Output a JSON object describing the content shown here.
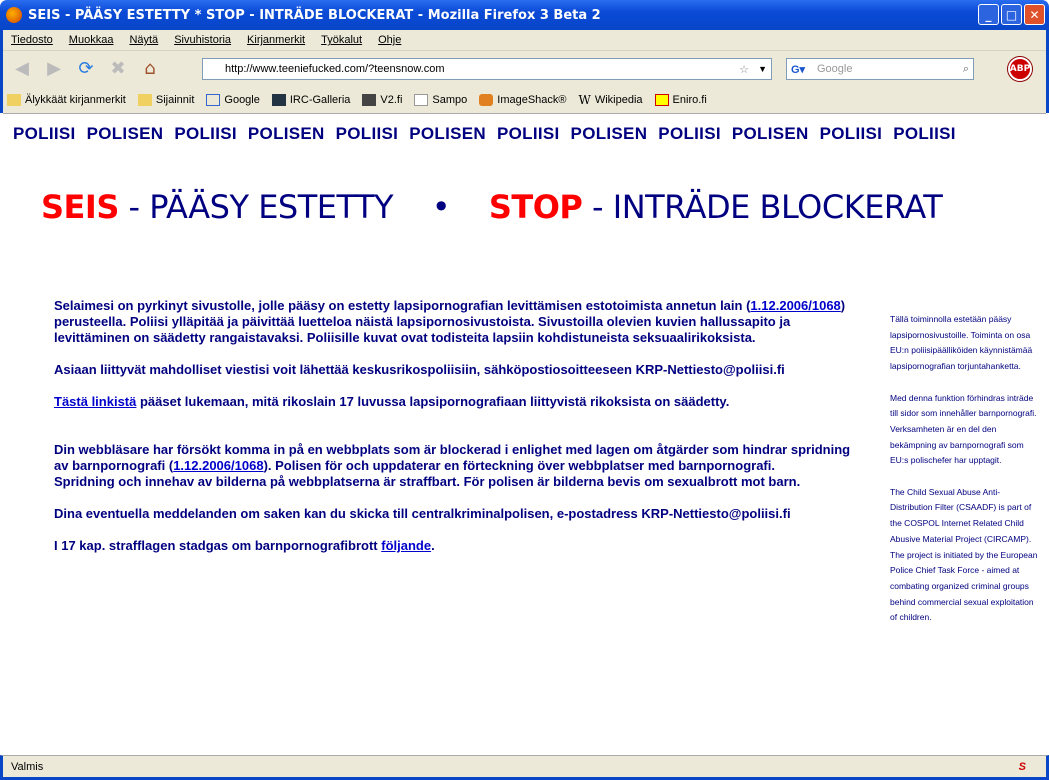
{
  "window": {
    "title": "SEIS - PÄÄSY ESTETTY * STOP - INTRÄDE BLOCKERAT - Mozilla Firefox 3 Beta 2"
  },
  "menu": [
    "Tiedosto",
    "Muokkaa",
    "Näytä",
    "Sivuhistoria",
    "Kirjanmerkit",
    "Työkalut",
    "Ohje"
  ],
  "url": "http://www.teeniefucked.com/?teensnow.com",
  "search_placeholder": "Google",
  "abp": "ABP",
  "bookmarks": [
    "Älykkäät kirjanmerkit",
    "Sijainnit",
    "Google",
    "IRC-Galleria",
    "V2.fi",
    "Sampo",
    "ImageShack®",
    "Wikipedia",
    "Eniro.fi"
  ],
  "police_banner": "POLIISI POLISEN POLIISI POLISEN POLIISI POLISEN POLIISI POLISEN POLIISI POLISEN POLIISI POLIISI",
  "headline": {
    "seis": "SEIS",
    "fi": " - PÄÄSY ESTETTY",
    "bullet": "•",
    "stop": "STOP",
    "sv": " - INTRÄDE BLOCKERAT"
  },
  "fi": {
    "p1a": "Selaimesi on pyrkinyt sivustolle, jolle pääsy on estetty lapsipornografian levittämisen estotoimista annetun lain (",
    "law_link": "1.12.2006/1068",
    "p1b": ") perusteella. Poliisi ylläpitää ja päivittää luetteloa näistä lapsipornosivustoista. Sivustoilla olevien kuvien hallussapito ja levittäminen on säädetty rangaistavaksi. Poliisille kuvat ovat todisteita lapsiin kohdistuneista seksuaalirikoksista.",
    "p2": "Asiaan liittyvät mahdolliset viestisi voit lähettää keskusrikospoliisiin, sähköpostiosoitteeseen  KRP-Nettiesto@poliisi.fi",
    "link": "Tästä linkistä",
    "p3": " pääset lukemaan, mitä rikoslain 17 luvussa lapsipornografiaan liittyvistä rikoksista on säädetty."
  },
  "sv": {
    "p1a": "Din webbläsare har försökt komma in på en webbplats som är blockerad i enlighet med lagen om åtgärder som hindrar spridning av barnpornografi (",
    "law_link": "1.12.2006/1068",
    "p1b": "). Polisen för och uppdaterar en förteckning över webbplatser med barnpornografi.",
    "p1c": "Spridning och innehav av bilderna på webbplatserna är straffbart. För polisen är bilderna bevis om sexualbrott mot barn.",
    "p2": "Dina eventuella meddelanden om saken kan du skicka till centralkriminalpolisen, e-postadress  KRP-Nettiesto@poliisi.fi",
    "p3a": "I 17 kap. strafflagen stadgas om barnpornografibrott ",
    "link": "följande",
    "p3b": "."
  },
  "side": {
    "fi": "Tällä toiminnolla estetään pääsy lapsipornosivustoille. Toiminta on osa EU:n poliisipäälliköiden käynnistämää lapsipornografian torjuntahanketta.",
    "sv": "Med denna funktion förhindras inträde till sidor som innehåller barnpornografi. Verksamheten är en del den bekämpning av barnpornografi som EU:s polischefer har upptagit.",
    "en": "The Child Sexual Abuse Anti-Distribution Filter (CSAADF) is part of the COSPOL Internet Related Child Abusive Material Project (CIRCAMP). The project is initiated by the European Police Chief Task Force - aimed at combating organized criminal groups behind commercial sexual exploitation of children."
  },
  "status": "Valmis"
}
